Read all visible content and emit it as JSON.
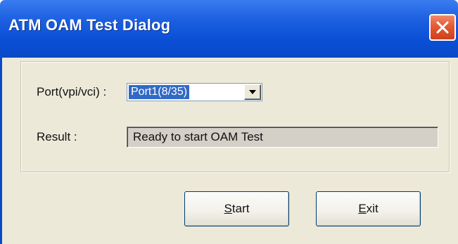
{
  "dialog": {
    "title": "ATM OAM Test Dialog"
  },
  "form": {
    "port_label": "Port(vpi/vci) :",
    "port_selected": "Port1(8/35)",
    "result_label": "Result :",
    "result_value": "Ready to start OAM Test"
  },
  "buttons": {
    "start": {
      "mnemonic": "S",
      "rest": "tart"
    },
    "exit": {
      "mnemonic": "E",
      "rest": "xit"
    }
  },
  "icons": {
    "close": "close-icon",
    "dropdown": "chevron-down-icon"
  },
  "colors": {
    "titlebar": "#0a4fd6",
    "close_button": "#e25a34",
    "selection": "#316ac5",
    "dialog_face": "#ece9d8"
  }
}
